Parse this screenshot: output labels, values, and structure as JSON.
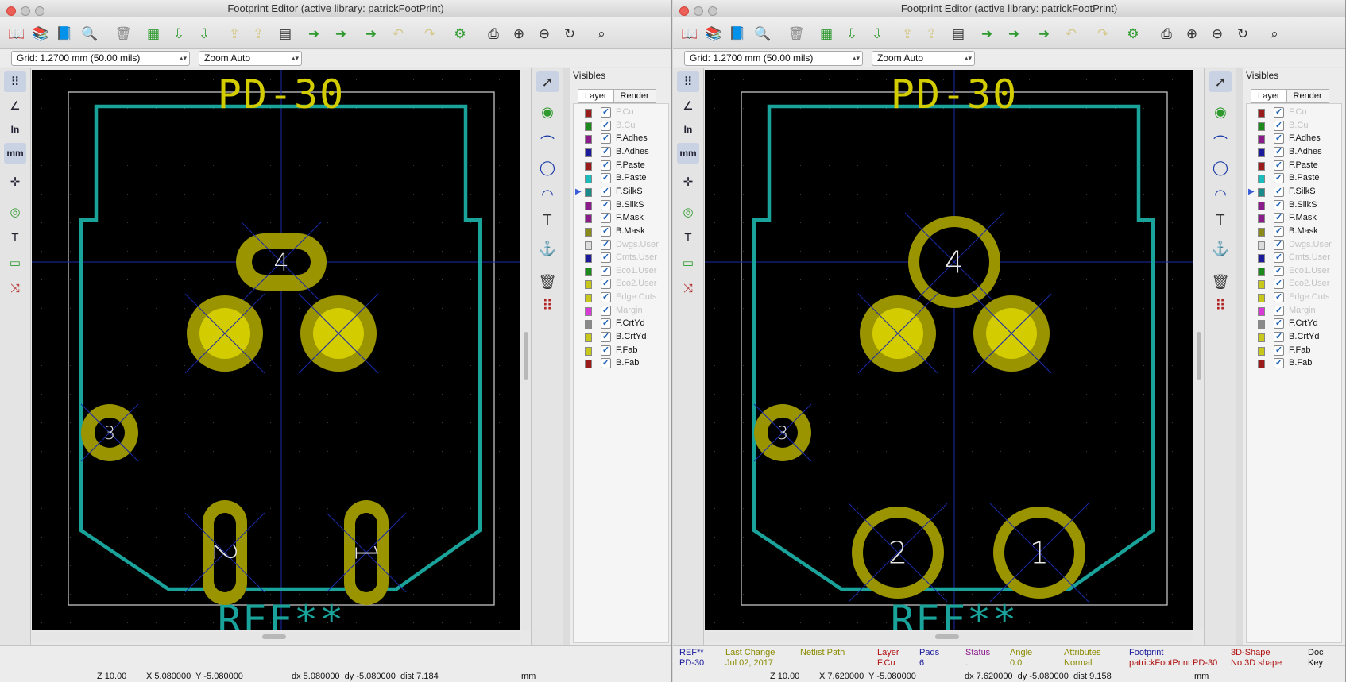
{
  "windows": [
    {
      "id": "left",
      "title": "Footprint Editor (active library: patrickFootPrint)",
      "grid": "Grid: 1.2700 mm (50.00 mils)",
      "zoom": "Zoom Auto",
      "footprint_name": "PD-30",
      "reference": "REF**",
      "pads": [
        {
          "num": "4",
          "shape": "oval-horizontal"
        },
        {
          "num": "",
          "shape": "round-filled"
        },
        {
          "num": "",
          "shape": "round-filled"
        },
        {
          "num": "3",
          "shape": "ring-small"
        },
        {
          "num": "2",
          "shape": "oval-vertical"
        },
        {
          "num": "1",
          "shape": "oval-vertical"
        }
      ],
      "status": {
        "messages": [],
        "z": "Z 10.00",
        "xy": "X 5.080000  Y -5.080000",
        "delta": "dx 5.080000  dy -5.080000  dist 7.184",
        "units": "mm"
      }
    },
    {
      "id": "right",
      "title": "Footprint Editor (active library: patrickFootPrint)",
      "grid": "Grid: 1.2700 mm (50.00 mils)",
      "zoom": "Zoom Auto",
      "footprint_name": "PD-30",
      "reference": "REF**",
      "pads": [
        {
          "num": "4",
          "shape": "ring-large"
        },
        {
          "num": "",
          "shape": "round-filled"
        },
        {
          "num": "",
          "shape": "round-filled"
        },
        {
          "num": "3",
          "shape": "ring-small"
        },
        {
          "num": "2",
          "shape": "ring-large"
        },
        {
          "num": "1",
          "shape": "ring-large"
        }
      ],
      "status": {
        "messages": [
          {
            "label": "REF**",
            "value": "PD-30",
            "color": "#1a1a9c",
            "vcolor": "#1a1a9c"
          },
          {
            "label": "Last Change",
            "value": "Jul 02, 2017",
            "color": "#8a8a00",
            "vcolor": "#8a8a00"
          },
          {
            "label": "Netlist Path",
            "value": "",
            "color": "#8a8a00",
            "vcolor": "#8a8a00"
          },
          {
            "label": "Layer",
            "value": "F.Cu",
            "color": "#b01010",
            "vcolor": "#b01010"
          },
          {
            "label": "Pads",
            "value": "6",
            "color": "#1a1a9c",
            "vcolor": "#1a1a9c"
          },
          {
            "label": "Status",
            "value": "..",
            "color": "#8a1a8a",
            "vcolor": "#8a1a8a"
          },
          {
            "label": "Angle",
            "value": "0.0",
            "color": "#8a8a00",
            "vcolor": "#8a8a00"
          },
          {
            "label": "Attributes",
            "value": "Normal",
            "color": "#8a8a00",
            "vcolor": "#8a8a00"
          },
          {
            "label": "Footprint",
            "value": "patrickFootPrint:PD-30",
            "color": "#1a1a9c",
            "vcolor": "#b01010"
          },
          {
            "label": "3D-Shape",
            "value": "No 3D shape",
            "color": "#b01010",
            "vcolor": "#b01010"
          },
          {
            "label": "Doc",
            "value": "Key",
            "color": "#111111",
            "vcolor": "#111111"
          }
        ],
        "z": "Z 10.00",
        "xy": "X 7.620000  Y -5.080000",
        "delta": "dx 7.620000  dy -5.080000  dist 9.158",
        "units": "mm"
      }
    }
  ],
  "visibles": {
    "title": "Visibles",
    "tabs": [
      "Layer",
      "Render"
    ],
    "layers": [
      {
        "name": "F.Cu",
        "color": "#9b1b1b",
        "enabled": false,
        "active": false
      },
      {
        "name": "B.Cu",
        "color": "#1b8a1b",
        "enabled": false,
        "active": false
      },
      {
        "name": "F.Adhes",
        "color": "#8a1b8a",
        "enabled": true,
        "active": false
      },
      {
        "name": "B.Adhes",
        "color": "#1b1b9b",
        "enabled": true,
        "active": false
      },
      {
        "name": "F.Paste",
        "color": "#9b1b1b",
        "enabled": true,
        "active": false
      },
      {
        "name": "B.Paste",
        "color": "#1bbcbc",
        "enabled": true,
        "active": false
      },
      {
        "name": "F.SilkS",
        "color": "#1b8a8a",
        "enabled": true,
        "active": true
      },
      {
        "name": "B.SilkS",
        "color": "#8a1b8a",
        "enabled": true,
        "active": false
      },
      {
        "name": "F.Mask",
        "color": "#8a1b8a",
        "enabled": true,
        "active": false
      },
      {
        "name": "B.Mask",
        "color": "#8a8a1b",
        "enabled": true,
        "active": false
      },
      {
        "name": "Dwgs.User",
        "color": "#dcdcdc",
        "enabled": false,
        "active": false
      },
      {
        "name": "Cmts.User",
        "color": "#1b1b9b",
        "enabled": false,
        "active": false
      },
      {
        "name": "Eco1.User",
        "color": "#1b8a1b",
        "enabled": false,
        "active": false
      },
      {
        "name": "Eco2.User",
        "color": "#c8c81b",
        "enabled": false,
        "active": false
      },
      {
        "name": "Edge.Cuts",
        "color": "#c8c81b",
        "enabled": false,
        "active": false
      },
      {
        "name": "Margin",
        "color": "#d83ad8",
        "enabled": false,
        "active": false
      },
      {
        "name": "F.CrtYd",
        "color": "#8a8a8a",
        "enabled": true,
        "active": false
      },
      {
        "name": "B.CrtYd",
        "color": "#c8c81b",
        "enabled": true,
        "active": false
      },
      {
        "name": "F.Fab",
        "color": "#c8c81b",
        "enabled": true,
        "active": false
      },
      {
        "name": "B.Fab",
        "color": "#9b1b1b",
        "enabled": true,
        "active": false
      }
    ]
  },
  "toolbar_icons": [
    "book-open-icon",
    "book-stack-icon",
    "book-icon",
    "search-library-icon",
    "delete-icon",
    "board-icon",
    "load-icon",
    "import-icon",
    "export-icon",
    "save-icon",
    "save-library-icon",
    "save-as-icon",
    "load-board-icon",
    "update-board-icon",
    "undo-icon",
    "redo-icon",
    "properties-icon",
    "print-icon",
    "zoom-in-icon",
    "zoom-out-icon",
    "refresh-icon",
    "zoom-fit-icon",
    "settings-icon"
  ],
  "left_tools": [
    "grid-icon",
    "polar-coords-icon",
    "inch-units-icon",
    "mm-units-icon",
    "cursor-shape-icon",
    "pad-highlight-icon",
    "text-sketch-icon",
    "module-edges-icon",
    "ratsnest-icon"
  ],
  "right_tools": [
    "select-icon",
    "pad-icon",
    "line-icon",
    "circle-icon",
    "arc-icon",
    "text-icon",
    "anchor-icon",
    "delete-icon",
    "grid-origin-icon"
  ],
  "colors": {
    "silk": "#1aa39a",
    "copper": "#9a9400",
    "copper_fill": "#d2cc00",
    "courtyard": "#c4c4c4",
    "crosshair": "#1a2aa8"
  }
}
